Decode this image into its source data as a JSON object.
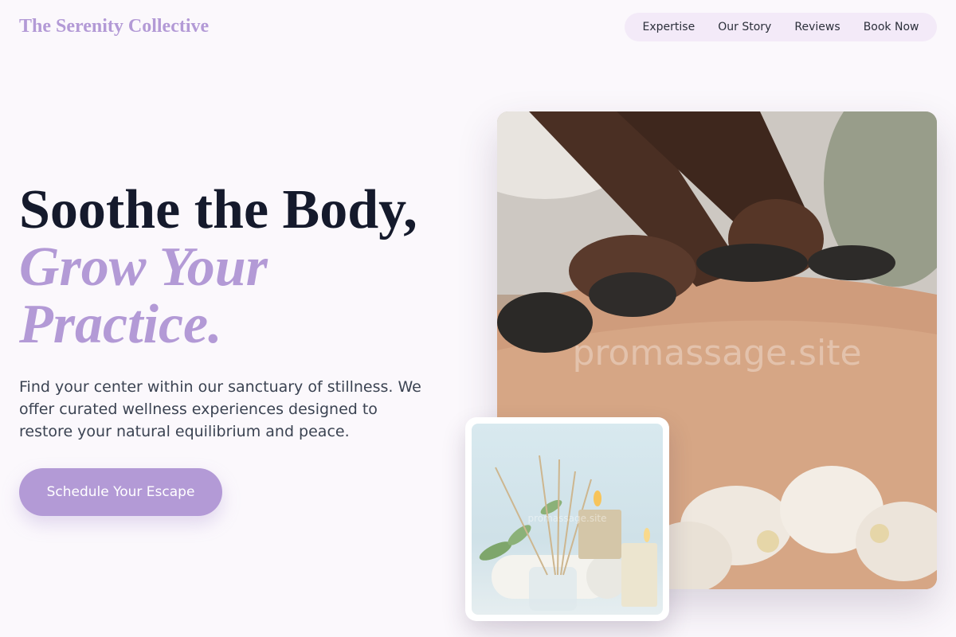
{
  "header": {
    "logo": "The Serenity Collective",
    "nav": [
      "Expertise",
      "Our Story",
      "Reviews",
      "Book Now"
    ]
  },
  "hero": {
    "headline_line1": "Soothe the Body,",
    "headline_accent": "Grow Your Practice.",
    "intro": "Find your center within our sanctuary of stillness. We offer curated wellness experiences designed to restore your natural equilibrium and peace.",
    "cta_label": "Schedule Your Escape"
  },
  "images": {
    "main_watermark": "promassage.site",
    "small_watermark": "promassage.site"
  },
  "colors": {
    "accent": "#b39ad6",
    "nav_background": "#f3eaf8",
    "page_background": "#fbf8fc",
    "headline": "#151a2c"
  }
}
